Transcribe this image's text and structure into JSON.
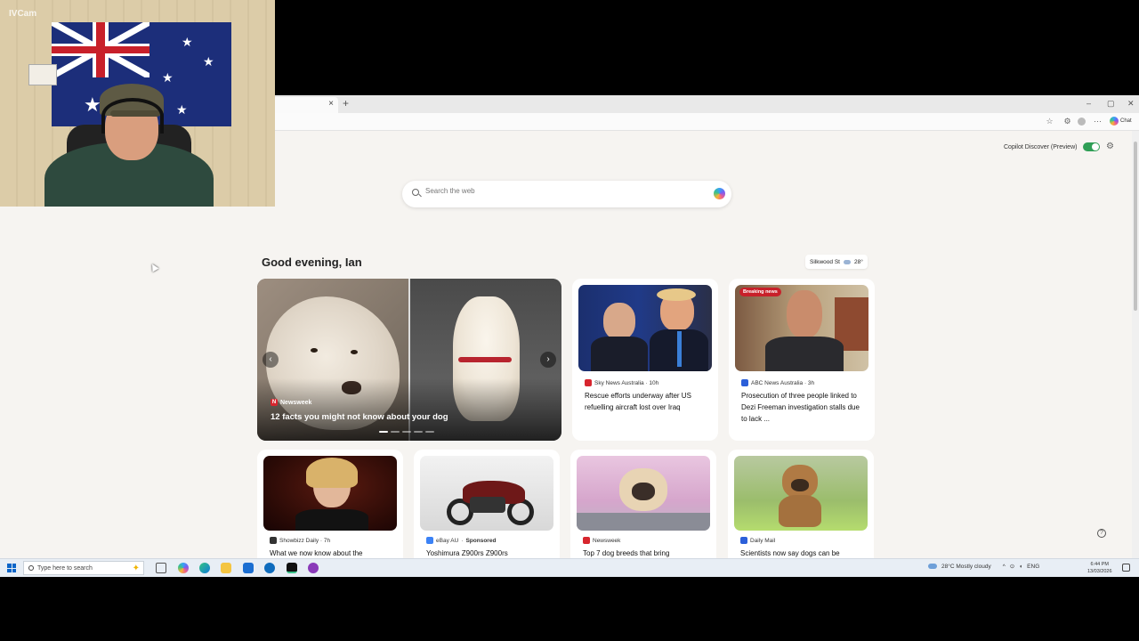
{
  "webcam": {
    "watermark": "IVCam"
  },
  "browser": {
    "tab_close": "×",
    "new_tab": "+",
    "window_controls": [
      "–",
      "▢",
      "✕"
    ],
    "toolbar_chat_label": "Chat"
  },
  "newtab": {
    "copilot_discover_label": "Copilot Discover (Preview)",
    "copilot_discover_enabled": true,
    "search_placeholder": "Search the web",
    "greeting": "Good evening, Ian",
    "weather": {
      "location": "Silkwood St",
      "temp": "28°"
    },
    "hero": {
      "source": "Newsweek",
      "source_badge": "N",
      "title": "12 facts you might not know about your dog",
      "prev_glyph": "‹",
      "next_glyph": "›"
    },
    "cards_row1": [
      {
        "source": "Sky News Australia · 10h",
        "title": "Rescue efforts underway after US refuelling aircraft lost over Iraq"
      },
      {
        "badge": "Breaking news",
        "source": "ABC News Australia · 3h",
        "title": "Prosecution of three people linked to Dezi Freeman investigation stalls due to lack ..."
      }
    ],
    "cards_row2": [
      {
        "source": "Showbizz Daily · 7h",
        "title": "What we now know about the"
      },
      {
        "source": "eBay AU",
        "sponsored": "Sponsored",
        "title": "Yoshimura Z900rs Z900rs"
      },
      {
        "source": "Newsweek",
        "title": "Top 7 dog breeds that bring"
      },
      {
        "source": "Daily Mail",
        "title": "Scientists now say dogs can be"
      }
    ],
    "help_glyph": "?"
  },
  "taskbar": {
    "search_placeholder": "Type here to search",
    "weather_text": "28°C  Mostly cloudy",
    "language": "ENG",
    "time": "6:44 PM",
    "date": "13/03/2026"
  },
  "colors": {
    "accent_green": "#2f9e55",
    "breaking_red": "#c8202a",
    "windows_blue": "#0a64c8"
  }
}
